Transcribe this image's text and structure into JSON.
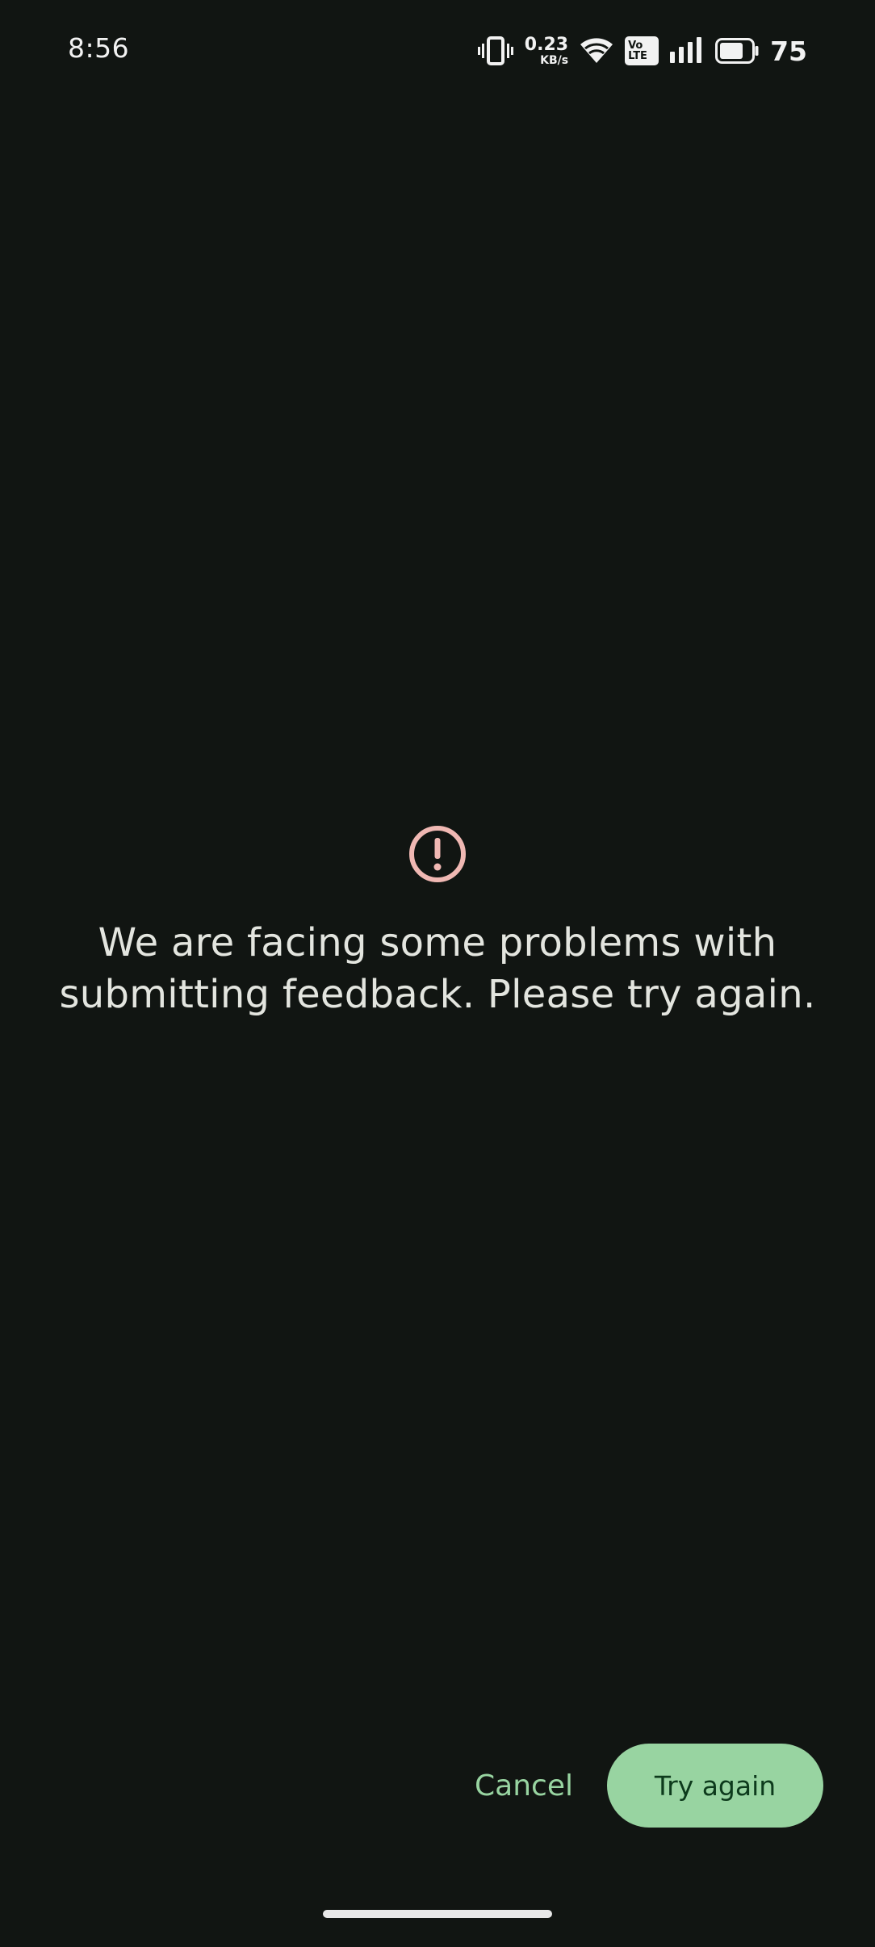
{
  "status_bar": {
    "time": "8:56",
    "net_speed_value": "0.23",
    "net_speed_unit": "KB/s",
    "volte_top": "Vo",
    "volte_bottom": "LTE",
    "battery_percent": "75",
    "icons": [
      "vibrate-icon",
      "wifi-icon",
      "volte-icon",
      "signal-icon",
      "battery-icon"
    ]
  },
  "error": {
    "icon": "error-icon",
    "icon_color": "#f0b8b3",
    "message": "We are facing some problems with submitting feedback. Please try again."
  },
  "actions": {
    "cancel_label": "Cancel",
    "try_again_label": "Try again",
    "accent_color": "#98d4a1"
  }
}
